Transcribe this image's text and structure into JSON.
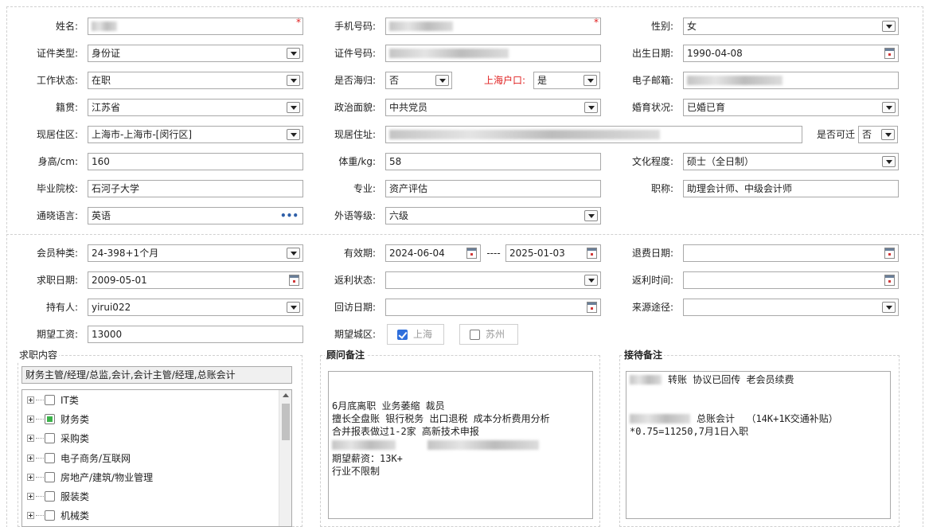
{
  "personal": {
    "name_label": "姓名:",
    "phone_label": "手机号码:",
    "gender_label": "性别:",
    "gender_value": "女",
    "id_type_label": "证件类型:",
    "id_type_value": "身份证",
    "id_number_label": "证件号码:",
    "birthdate_label": "出生日期:",
    "birthdate_value": "1990-04-08",
    "work_status_label": "工作状态:",
    "work_status_value": "在职",
    "returnee_label": "是否海归:",
    "returnee_value": "否",
    "shanghai_hukou_label": "上海户口:",
    "shanghai_hukou_value": "是",
    "email_label": "电子邮箱:",
    "native_place_label": "籍贯:",
    "native_place_value": "江苏省",
    "political_label": "政治面貌:",
    "political_value": "中共党员",
    "marital_label": "婚育状况:",
    "marital_value": "已婚已育",
    "residence_area_label": "现居住区:",
    "residence_area_value": "上海市-上海市-[闵行区]",
    "residence_address_label": "现居住址:",
    "relocate_label": "是否可迁",
    "relocate_value": "否",
    "height_label": "身高/cm:",
    "height_value": "160",
    "weight_label": "体重/kg:",
    "weight_value": "58",
    "education_label": "文化程度:",
    "education_value": "硕士（全日制）",
    "school_label": "毕业院校:",
    "school_value": "石河子大学",
    "major_label": "专业:",
    "major_value": "资产评估",
    "title_label": "职称:",
    "title_value": "助理会计师、中级会计师",
    "language_label": "通晓语言:",
    "language_value": "英语",
    "foreign_level_label": "外语等级:",
    "foreign_level_value": "六级"
  },
  "membership": {
    "member_type_label": "会员种类:",
    "member_type_value": "24-398+1个月",
    "valid_label": "有效期:",
    "valid_from": "2024-06-04",
    "valid_sep": "----",
    "valid_to": "2025-01-03",
    "refund_date_label": "退费日期:",
    "job_date_label": "求职日期:",
    "job_date_value": "2009-05-01",
    "rebate_status_label": "返利状态:",
    "rebate_time_label": "返利时间:",
    "holder_label": "持有人:",
    "holder_value": "yirui022",
    "revisit_label": "回访日期:",
    "source_label": "来源途径:",
    "salary_label": "期望工资:",
    "salary_value": "13000",
    "city_label": "期望城区:",
    "city_shanghai": "上海",
    "city_suzhou": "苏州"
  },
  "job_content": {
    "title": "求职内容",
    "summary": "财务主管/经理/总监,会计,会计主管/经理,总账会计",
    "tree": [
      {
        "label": "IT类",
        "state": "none"
      },
      {
        "label": "财务类",
        "state": "partial"
      },
      {
        "label": "采购类",
        "state": "none"
      },
      {
        "label": "电子商务/互联网",
        "state": "none"
      },
      {
        "label": "房地产/建筑/物业管理",
        "state": "none"
      },
      {
        "label": "服装类",
        "state": "none"
      },
      {
        "label": "机械类",
        "state": "none"
      }
    ]
  },
  "consultant_notes": {
    "title": "顾问备注",
    "lines": [
      "6月底离职 业务萎缩 裁员",
      "擅长全盘账 银行税务 出口退税 成本分析费用分析",
      "合并报表做过1-2家 高新技术申报",
      "期望薪资：13K+",
      "行业不限制"
    ]
  },
  "reception_notes": {
    "title": "接待备注",
    "line1": "转账 协议已回传 老会员续费",
    "line2": "总账会计  （14K+1K交通补贴）",
    "line3": "*0.75=11250,7月1日入职"
  }
}
